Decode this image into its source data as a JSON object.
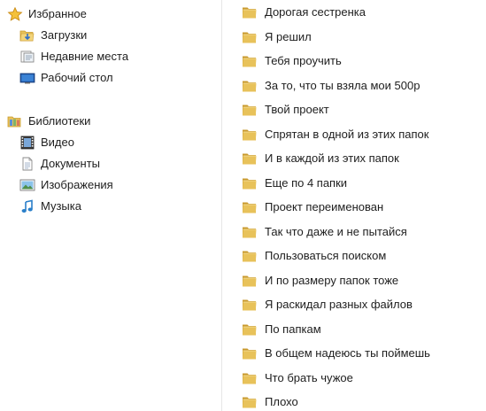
{
  "nav": {
    "favorites": {
      "label": "Избранное",
      "icon": "star-icon",
      "items": [
        {
          "label": "Загрузки",
          "icon": "downloads-folder-icon"
        },
        {
          "label": "Недавние места",
          "icon": "recent-places-icon"
        },
        {
          "label": "Рабочий стол",
          "icon": "desktop-icon"
        }
      ]
    },
    "libraries": {
      "label": "Библиотеки",
      "icon": "libraries-icon",
      "items": [
        {
          "label": "Видео",
          "icon": "video-library-icon"
        },
        {
          "label": "Документы",
          "icon": "documents-library-icon"
        },
        {
          "label": "Изображения",
          "icon": "pictures-library-icon"
        },
        {
          "label": "Музыка",
          "icon": "music-library-icon"
        }
      ]
    }
  },
  "files": [
    {
      "name": "Дорогая сестренка",
      "icon": "folder-icon"
    },
    {
      "name": "Я решил",
      "icon": "folder-icon"
    },
    {
      "name": "Тебя проучить",
      "icon": "folder-icon"
    },
    {
      "name": "За то, что ты взяла мои 500р",
      "icon": "folder-icon"
    },
    {
      "name": "Твой проект",
      "icon": "folder-icon"
    },
    {
      "name": "Спрятан в одной из этих папок",
      "icon": "folder-icon"
    },
    {
      "name": "И в каждой из этих папок",
      "icon": "folder-icon"
    },
    {
      "name": "Еще по 4 папки",
      "icon": "folder-icon"
    },
    {
      "name": "Проект переименован",
      "icon": "folder-icon"
    },
    {
      "name": "Так что даже и не пытайся",
      "icon": "folder-icon"
    },
    {
      "name": "Пользоваться поиском",
      "icon": "folder-icon"
    },
    {
      "name": "И по размеру папок тоже",
      "icon": "folder-icon"
    },
    {
      "name": "Я раскидал разных файлов",
      "icon": "folder-icon"
    },
    {
      "name": "По папкам",
      "icon": "folder-icon"
    },
    {
      "name": "В общем надеюсь ты поймешь",
      "icon": "folder-icon"
    },
    {
      "name": "Что брать чужое",
      "icon": "folder-icon"
    },
    {
      "name": "Плохо",
      "icon": "folder-icon"
    }
  ],
  "colors": {
    "folder": "#e8c25a",
    "folder_dark": "#c99a2e",
    "star": "#f2b632",
    "text": "#1e1e1e"
  }
}
